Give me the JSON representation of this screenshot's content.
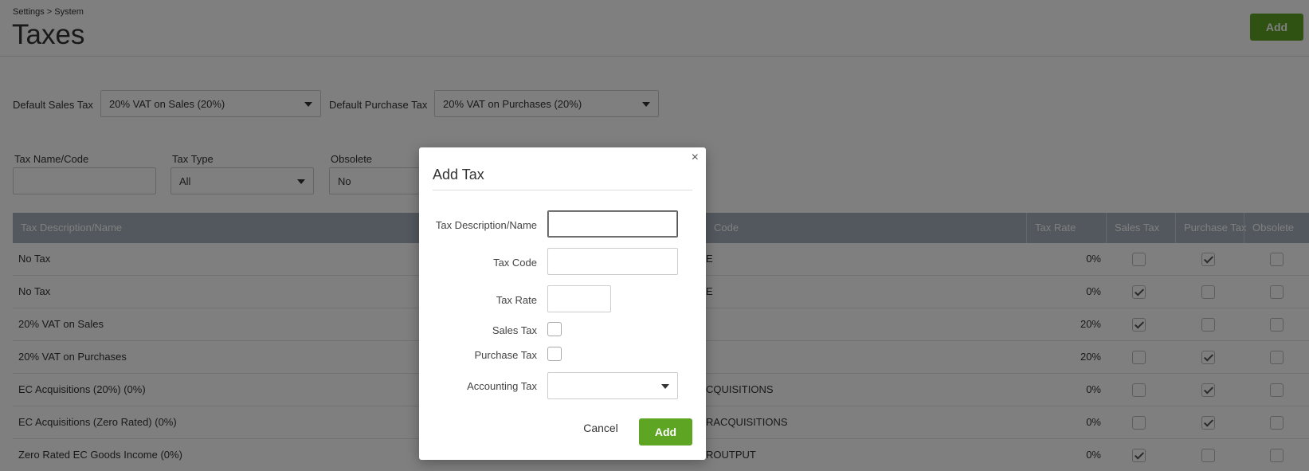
{
  "header": {
    "breadcrumb": "Settings > System",
    "title": "Taxes",
    "add_button": "Add"
  },
  "defaults": {
    "sales_label": "Default Sales Tax",
    "sales_value": "20% VAT on Sales (20%)",
    "purchase_label": "Default Purchase Tax",
    "purchase_value": "20% VAT on Purchases (20%)"
  },
  "filters": {
    "name_label": "Tax Name/Code",
    "name_value": "",
    "type_label": "Tax Type",
    "type_value": "All",
    "obsolete_label": "Obsolete",
    "obsolete_value": "No"
  },
  "table": {
    "columns": [
      "Tax Description/Name",
      "Code",
      "Tax Rate",
      "Sales Tax",
      "Purchase Tax",
      "Obsolete"
    ],
    "rows": [
      {
        "name": "No Tax",
        "code": "E",
        "rate": "0%",
        "sales": false,
        "purchase": true,
        "obsolete": false
      },
      {
        "name": "No Tax",
        "code": "E",
        "rate": "0%",
        "sales": true,
        "purchase": false,
        "obsolete": false
      },
      {
        "name": "20% VAT on Sales",
        "code": "",
        "rate": "20%",
        "sales": true,
        "purchase": false,
        "obsolete": false
      },
      {
        "name": "20% VAT on Purchases",
        "code": "",
        "rate": "20%",
        "sales": false,
        "purchase": true,
        "obsolete": false
      },
      {
        "name": "EC Acquisitions (20%) (0%)",
        "code": "CQUISITIONS",
        "rate": "0%",
        "sales": false,
        "purchase": true,
        "obsolete": false
      },
      {
        "name": "EC Acquisitions (Zero Rated) (0%)",
        "code": "RACQUISITIONS",
        "rate": "0%",
        "sales": false,
        "purchase": true,
        "obsolete": false
      },
      {
        "name": "Zero Rated EC Goods Income (0%)",
        "code": "ROUTPUT",
        "rate": "0%",
        "sales": true,
        "purchase": false,
        "obsolete": false
      }
    ]
  },
  "modal": {
    "title": "Add Tax",
    "close_symbol": "×",
    "desc_label": "Tax Description/Name",
    "desc_value": "",
    "code_label": "Tax Code",
    "code_value": "",
    "rate_label": "Tax Rate",
    "rate_value": "",
    "sales_label": "Sales Tax",
    "sales_checked": false,
    "purchase_label": "Purchase Tax",
    "purchase_checked": false,
    "accounting_label": "Accounting Tax",
    "accounting_value": "",
    "cancel_label": "Cancel",
    "add_label": "Add"
  },
  "colors": {
    "accent_green": "#5ea524",
    "table_header": "#a6b1bc"
  },
  "icons": [
    "caret-down-icon",
    "close-icon",
    "checkmark-icon"
  ]
}
